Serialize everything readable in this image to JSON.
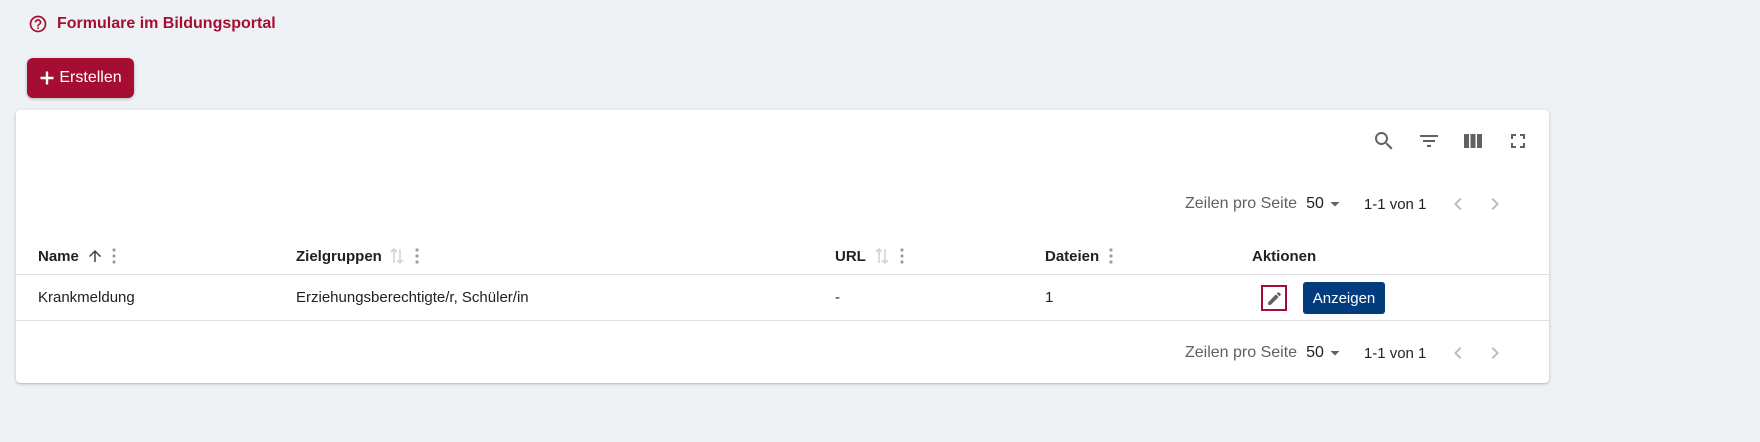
{
  "header": {
    "help_link": "Formulare im Bildungsportal",
    "create_button": "Erstellen"
  },
  "colors": {
    "brand": "#a50e32",
    "primary_button": "#033b7f",
    "background": "#eef2f5"
  },
  "toolbar": {
    "icons": [
      "search-icon",
      "filter-icon",
      "columns-icon",
      "fullscreen-icon"
    ]
  },
  "pagination": {
    "rows_per_page_label": "Zeilen pro Seite",
    "rows_per_page_value": "50",
    "range": "1-1 von 1"
  },
  "table": {
    "columns": [
      "Name",
      "Zielgruppen",
      "URL",
      "Dateien",
      "Aktionen"
    ],
    "rows": [
      {
        "name": "Krankmeldung",
        "zielgruppen": "Erziehungsberechtigte/r, Schüler/in",
        "url": "-",
        "dateien": "1",
        "action_label": "Anzeigen"
      }
    ]
  }
}
